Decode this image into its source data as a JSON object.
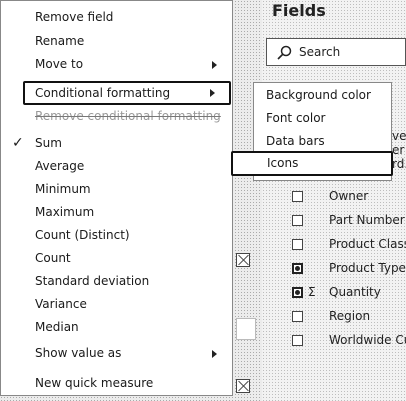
{
  "fields_pane": {
    "title": "Fields",
    "search_placeholder": "Search",
    "fields": [
      {
        "label": "Owner",
        "checked": false,
        "sigma": false
      },
      {
        "label": "Part Number",
        "checked": false,
        "sigma": false
      },
      {
        "label": "Product Class",
        "checked": false,
        "sigma": false
      },
      {
        "label": "Product Type",
        "checked": true,
        "sigma": false
      },
      {
        "label": "Quantity",
        "checked": true,
        "sigma": true
      },
      {
        "label": "Region",
        "checked": false,
        "sigma": false
      },
      {
        "label": "Worldwide Cu...",
        "checked": false,
        "sigma": false
      }
    ],
    "sigma_symbol": "Σ",
    "partial_text": [
      "ve.",
      "er",
      "rd."
    ]
  },
  "context_menu": {
    "items": [
      {
        "label": "Remove field"
      },
      {
        "label": "Rename"
      },
      {
        "label": "Move to",
        "has_submenu": true
      },
      {
        "label": "Conditional formatting",
        "has_submenu": true,
        "highlighted": true
      },
      {
        "label": "Remove conditional formatting",
        "disabled": true
      },
      {
        "label": "Sum",
        "checked": true
      },
      {
        "label": "Average"
      },
      {
        "label": "Minimum"
      },
      {
        "label": "Maximum"
      },
      {
        "label": "Count (Distinct)"
      },
      {
        "label": "Count"
      },
      {
        "label": "Standard deviation"
      },
      {
        "label": "Variance"
      },
      {
        "label": "Median"
      },
      {
        "label": "Show value as",
        "has_submenu": true
      },
      {
        "label": "New quick measure"
      }
    ],
    "check_glyph": "✓"
  },
  "submenu": {
    "items": [
      {
        "label": "Background color"
      },
      {
        "label": "Font color"
      },
      {
        "label": "Data bars"
      },
      {
        "label": "Icons",
        "highlighted": true
      }
    ]
  },
  "colors": {
    "menu_bg": "#ffffff",
    "highlight_border": "#111111",
    "disabled_text": "#9a9a9a"
  }
}
